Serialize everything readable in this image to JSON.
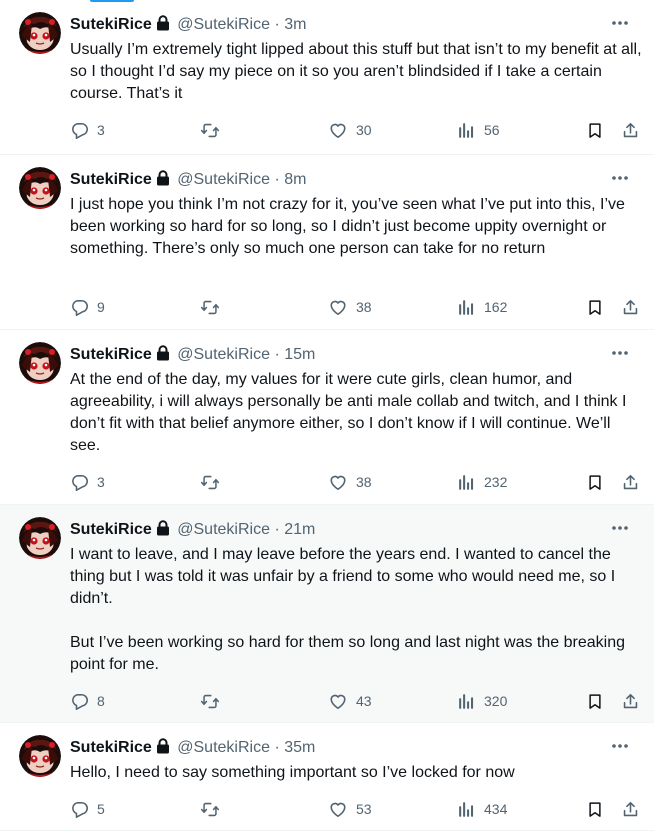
{
  "colors": {
    "accent": "#1d9bf0",
    "text": "#0f1419",
    "secondary": "#536471",
    "border": "#eff3f4",
    "highlight_bg": "#f7f9f9"
  },
  "icons": {
    "reply": "reply-icon",
    "retweet": "retweet-icon",
    "like": "like-icon",
    "views": "views-icon",
    "bookmark": "bookmark-icon",
    "share": "share-icon",
    "more": "more-icon",
    "lock": "lock-icon"
  },
  "tweets": [
    {
      "display_name": "SutekiRice",
      "handle": "@SutekiRice",
      "separator": "·",
      "time": "3m",
      "text": "Usually I’m extremely tight lipped about this stuff but that isn’t to my benefit at all, so I thought I’d say my piece on it so you aren’t blindsided if I take a certain course. That’s it",
      "replies": "3",
      "likes": "30",
      "views": "56"
    },
    {
      "display_name": "SutekiRice",
      "handle": "@SutekiRice",
      "separator": "·",
      "time": "8m",
      "text": "I just hope you think I’m not crazy for it, you’ve seen what I’ve put into this, I’ve been working so hard for so long, so I didn’t just become uppity overnight or something. There’s only so much one person can take for no return",
      "replies": "9",
      "likes": "38",
      "views": "162"
    },
    {
      "display_name": "SutekiRice",
      "handle": "@SutekiRice",
      "separator": "·",
      "time": "15m",
      "text": "At the end of the day, my values for it were cute girls, clean humor, and agreeability, i will always personally be anti male collab and twitch, and I think I don’t fit with that belief anymore either, so I don’t know if I will continue. We’ll see.",
      "replies": "3",
      "likes": "38",
      "views": "232"
    },
    {
      "display_name": "SutekiRice",
      "handle": "@SutekiRice",
      "separator": "·",
      "time": "21m",
      "text": "I want to leave, and I may leave before the years end. I wanted to cancel the thing but I was told it was unfair by a friend to some who would need me, so I didn’t.\n\nBut I’ve been working so hard for them so long and last night was the breaking point for me.",
      "replies": "8",
      "likes": "43",
      "views": "320"
    },
    {
      "display_name": "SutekiRice",
      "handle": "@SutekiRice",
      "separator": "·",
      "time": "35m",
      "text": "Hello, I need to say something important so I’ve locked for now",
      "replies": "5",
      "likes": "53",
      "views": "434"
    }
  ]
}
